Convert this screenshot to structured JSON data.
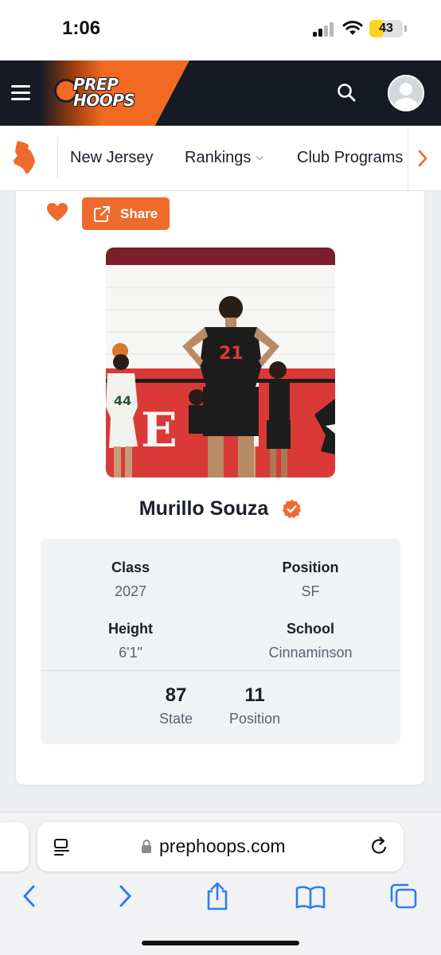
{
  "status_bar": {
    "time": "1:06",
    "battery": "43",
    "battery_fraction": 0.43
  },
  "navbar": {
    "logo_line1": "PREP",
    "logo_line2": "HOOPS"
  },
  "state_nav": {
    "items": [
      {
        "label": "New Jersey"
      },
      {
        "label": "Rankings",
        "has_dropdown": true
      },
      {
        "label": "Club Programs"
      }
    ]
  },
  "actions": {
    "share_label": "Share"
  },
  "player": {
    "name": "Murillo Souza",
    "verified": true,
    "photo_jersey_number": "21",
    "photo_other_number": "44"
  },
  "stats": [
    {
      "label": "Class",
      "value": "2027"
    },
    {
      "label": "Position",
      "value": "SF"
    },
    {
      "label": "Height",
      "value": "6'1\""
    },
    {
      "label": "School",
      "value": "Cinnaminson"
    }
  ],
  "ranks": [
    {
      "value": "87",
      "label": "State"
    },
    {
      "value": "11",
      "label": "Position"
    }
  ],
  "browser": {
    "url": "prephoops.com"
  },
  "colors": {
    "brand_orange": "#ee6b2d",
    "navbar": "#161a24",
    "ios_blue": "#2f7cf6"
  }
}
